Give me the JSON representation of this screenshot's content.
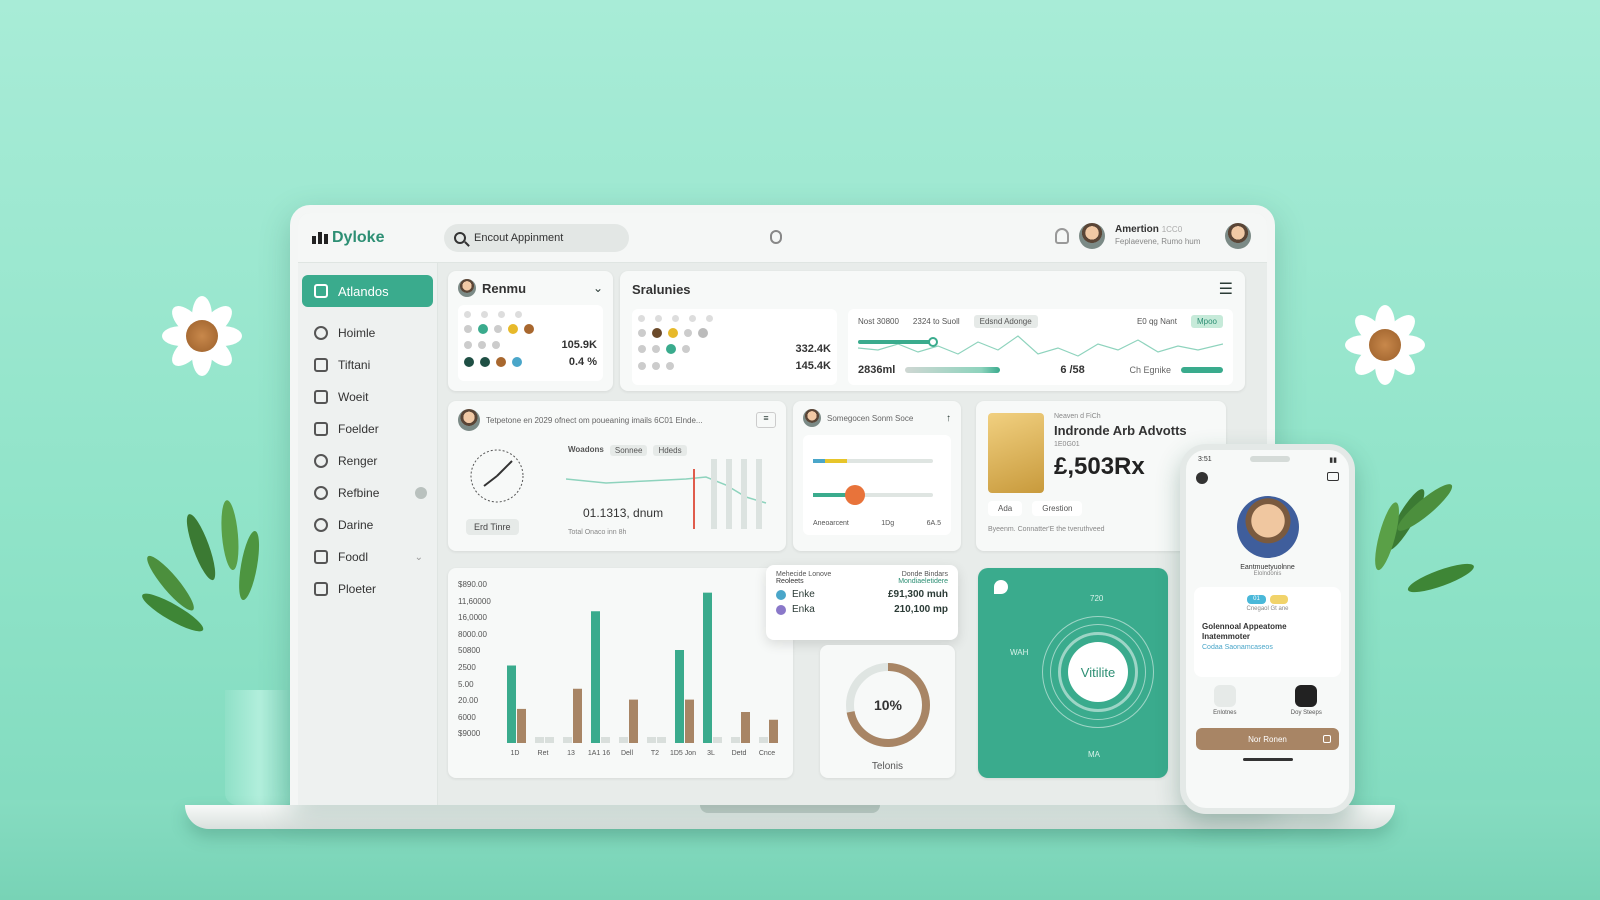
{
  "app": {
    "logo_text": "Dyloke",
    "search_placeholder": "Encout Appinment",
    "user_name": "Amertion",
    "user_sub": "Feplaevene, Rumo hum",
    "user_id": "1CC0"
  },
  "sidebar": {
    "active": "Atlandos",
    "items": [
      {
        "label": "Hoimle",
        "icon": "user-icon"
      },
      {
        "label": "Tiftani",
        "icon": "chart-icon"
      },
      {
        "label": "Woeit",
        "icon": "camera-icon"
      },
      {
        "label": "Foelder",
        "icon": "folder-icon"
      },
      {
        "label": "Renger",
        "icon": "search-icon"
      },
      {
        "label": "Refbine",
        "icon": "refresh-icon"
      },
      {
        "label": "Darine",
        "icon": "globe-icon"
      },
      {
        "label": "Foodl",
        "icon": "cup-icon"
      },
      {
        "label": "Ploeter",
        "icon": "clipboard-icon"
      }
    ]
  },
  "renmu": {
    "title": "Renmu",
    "val1": "105.9K",
    "val2": "0.4 %"
  },
  "sralunies": {
    "title": "Sralunies",
    "val1": "332.4K",
    "val2": "145.4K",
    "trend_label": "Nost 30800",
    "trend_sub": "2324 to Suoll",
    "chip": "Edsnd Adonge",
    "right_label": "E0 qg Nant",
    "right_chip": "Mpoo",
    "bottom_left": "2836ml",
    "bottom_mid": "6 /58",
    "bottom_right": "Ch Egnike"
  },
  "gauge_panel": {
    "header": "Tetpetone en 2029 ofnect om poueaning imails 6C01 Elnde...",
    "tabs": [
      "Woadons",
      "Sonnee",
      "Hdeds"
    ],
    "clock_btn": "Erd Tinre",
    "value": "01.1313, dnum",
    "footer": "Total Onaco inn 8h"
  },
  "sliders_panel": {
    "header": "Somegocen Sonm Soce",
    "footer_left": "Aneoarcent",
    "footer_mid": "1Dg",
    "footer_right": "6A.5"
  },
  "product": {
    "tag": "Neaven d FiCh",
    "title": "Indronde Arb Advotts",
    "code": "1E0G01",
    "price": "£,503Rx",
    "chip1": "Ada",
    "chip2": "Grestion",
    "footer": "Byeenm. Connatter'E the tveruthveed"
  },
  "bar_chart": {
    "yticks": [
      "$890.00",
      "11,60000",
      "16,0000",
      "8000.00",
      "50800",
      "2500",
      "5.00",
      "20.00",
      "6000",
      "$9000"
    ],
    "xticks": [
      "1D",
      "Ret",
      "13",
      "1A1 16",
      "Dell",
      "T2",
      "1D5 Jon",
      "3L",
      "Detd",
      "Cnce"
    ]
  },
  "chart_data": {
    "type": "bar",
    "categories": [
      "1D",
      "Ret",
      "13",
      "1A1 16",
      "Dell",
      "T2",
      "1D5 Jon",
      "3L",
      "Detd",
      "Cnce"
    ],
    "series": [
      {
        "values": [
          50,
          0,
          0,
          85,
          0,
          0,
          60,
          97,
          0,
          0
        ]
      },
      {
        "values": [
          22,
          0,
          35,
          0,
          28,
          0,
          28,
          0,
          20,
          15
        ]
      }
    ],
    "colors": [
      "#3aab8d",
      "#a88565"
    ]
  },
  "popover": {
    "head_left": "Mehecide Lonove",
    "head_left2": "Reoleets",
    "head_right": "Donde Bindars",
    "head_right2": "Mondiaeletidere",
    "rows": [
      {
        "label": "Enke",
        "value": "£91,300 muh"
      },
      {
        "label": "Enka",
        "value": "210,100 mp"
      }
    ]
  },
  "donut": {
    "value": "10%",
    "label": "Telonis",
    "fraction": 0.72
  },
  "green_card": {
    "center": "Vitilite",
    "top": "720",
    "left": "WAH",
    "bottom": "MA"
  },
  "phone": {
    "time": "3:51",
    "profile_name": "Eantmuetyuolnne",
    "profile_sub": "Elolndonis",
    "badge1": "01",
    "badge2": "",
    "small_line": "Cnegaol Gt ane",
    "card_title": "Golennoal Appeatome Inatemmoter",
    "card_link": "Codaa Saonamcaseos",
    "icon1_label": "Enlotnes",
    "icon2_label": "Doy Steeps",
    "cta": "Nor Ronen"
  },
  "colors": {
    "accent": "#3aab8d",
    "brown": "#a88565",
    "background": "#9fe8d2"
  }
}
